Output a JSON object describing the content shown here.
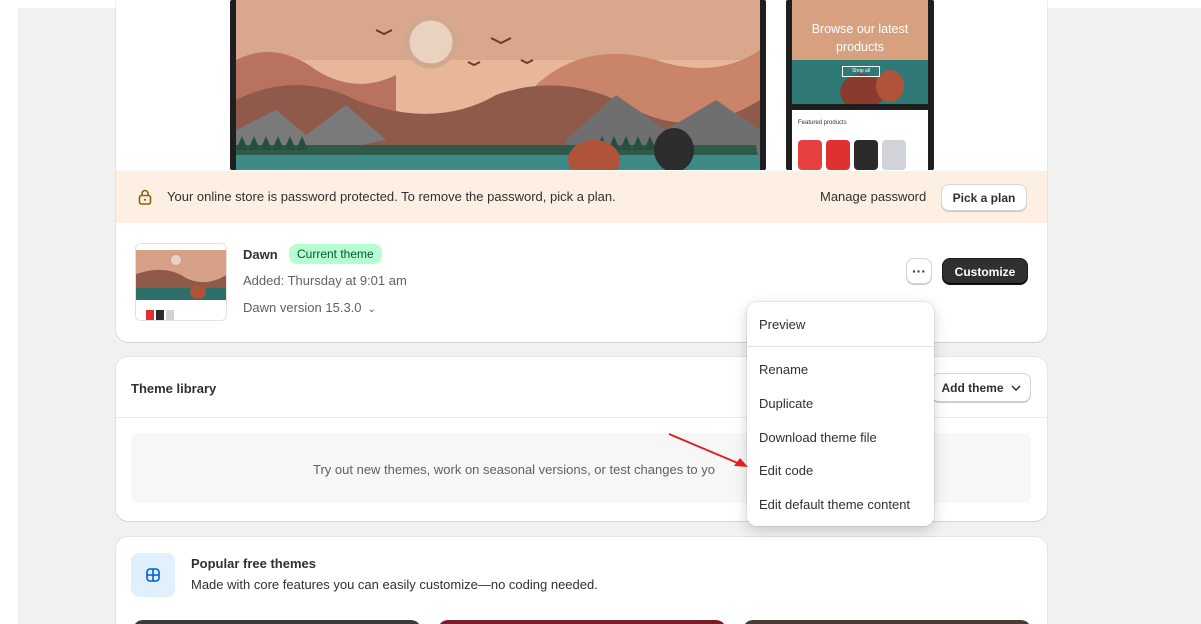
{
  "preview": {
    "mobile_hero_title": "Browse our latest products",
    "mobile_hero_button": "Shop all",
    "mobile_products_label": "Featured products"
  },
  "banner": {
    "message": "Your online store is password protected. To remove the password, pick a plan.",
    "manage_password": "Manage password",
    "pick_plan": "Pick a plan"
  },
  "current_theme": {
    "name": "Dawn",
    "badge": "Current theme",
    "added": "Added: Thursday at 9:01 am",
    "version": "Dawn version 15.3.0",
    "more_label": "···",
    "customize": "Customize"
  },
  "menu": {
    "items": [
      "Preview",
      "Rename",
      "Duplicate",
      "Download theme file",
      "Edit code",
      "Edit default theme content"
    ]
  },
  "library": {
    "title": "Theme library",
    "add_theme": "Add theme",
    "empty_text": "Try out new themes, work on seasonal versions, or test changes to yo"
  },
  "popular": {
    "title": "Popular free themes",
    "subtitle": "Made with core features you can easily customize—no coding needed."
  },
  "colors": {
    "banner_bg": "#fdf0e2",
    "badge_bg": "#b4fed2",
    "primary_button": "#303030",
    "annotation_arrow": "#e02020"
  }
}
